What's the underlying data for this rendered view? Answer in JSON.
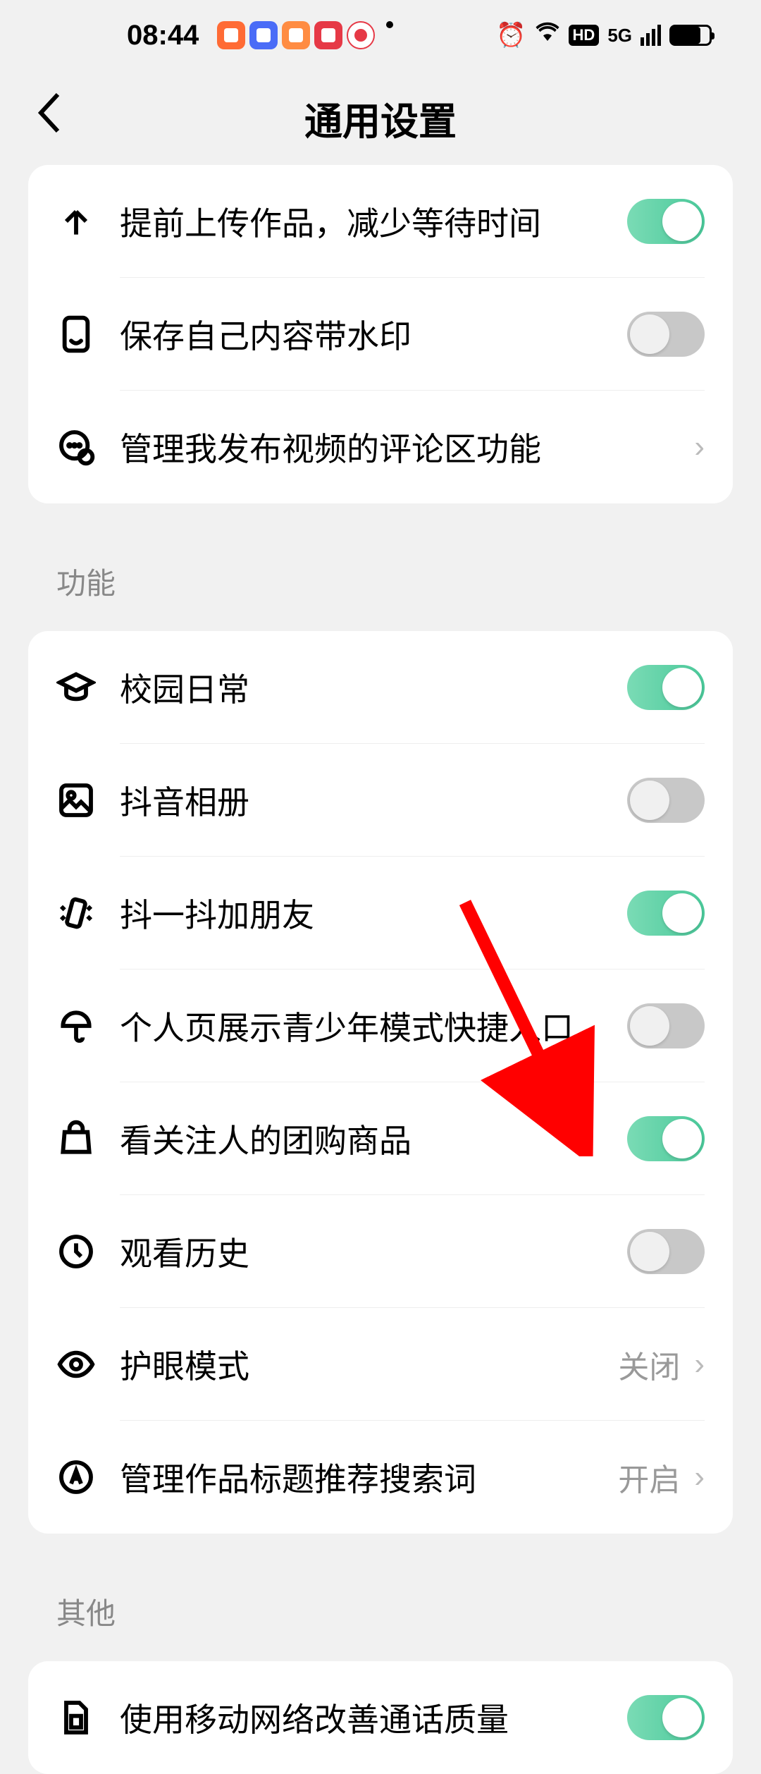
{
  "status": {
    "time": "08:44",
    "hd": "HD",
    "network": "5G"
  },
  "header": {
    "title": "通用设置"
  },
  "card1": {
    "row1": {
      "label": "提前上传作品，减少等待时间"
    },
    "row2": {
      "label": "保存自己内容带水印"
    },
    "row3": {
      "label": "管理我发布视频的评论区功能"
    }
  },
  "section_functions": "功能",
  "card2": {
    "row1": {
      "label": "校园日常"
    },
    "row2": {
      "label": "抖音相册"
    },
    "row3": {
      "label": "抖一抖加朋友"
    },
    "row4": {
      "label": "个人页展示青少年模式快捷入口"
    },
    "row5": {
      "label": "看关注人的团购商品"
    },
    "row6": {
      "label": "观看历史"
    },
    "row7": {
      "label": "护眼模式",
      "value": "关闭"
    },
    "row8": {
      "label": "管理作品标题推荐搜索词",
      "value": "开启"
    }
  },
  "section_other": "其他",
  "card3": {
    "row1": {
      "label": "使用移动网络改善通话质量"
    }
  }
}
